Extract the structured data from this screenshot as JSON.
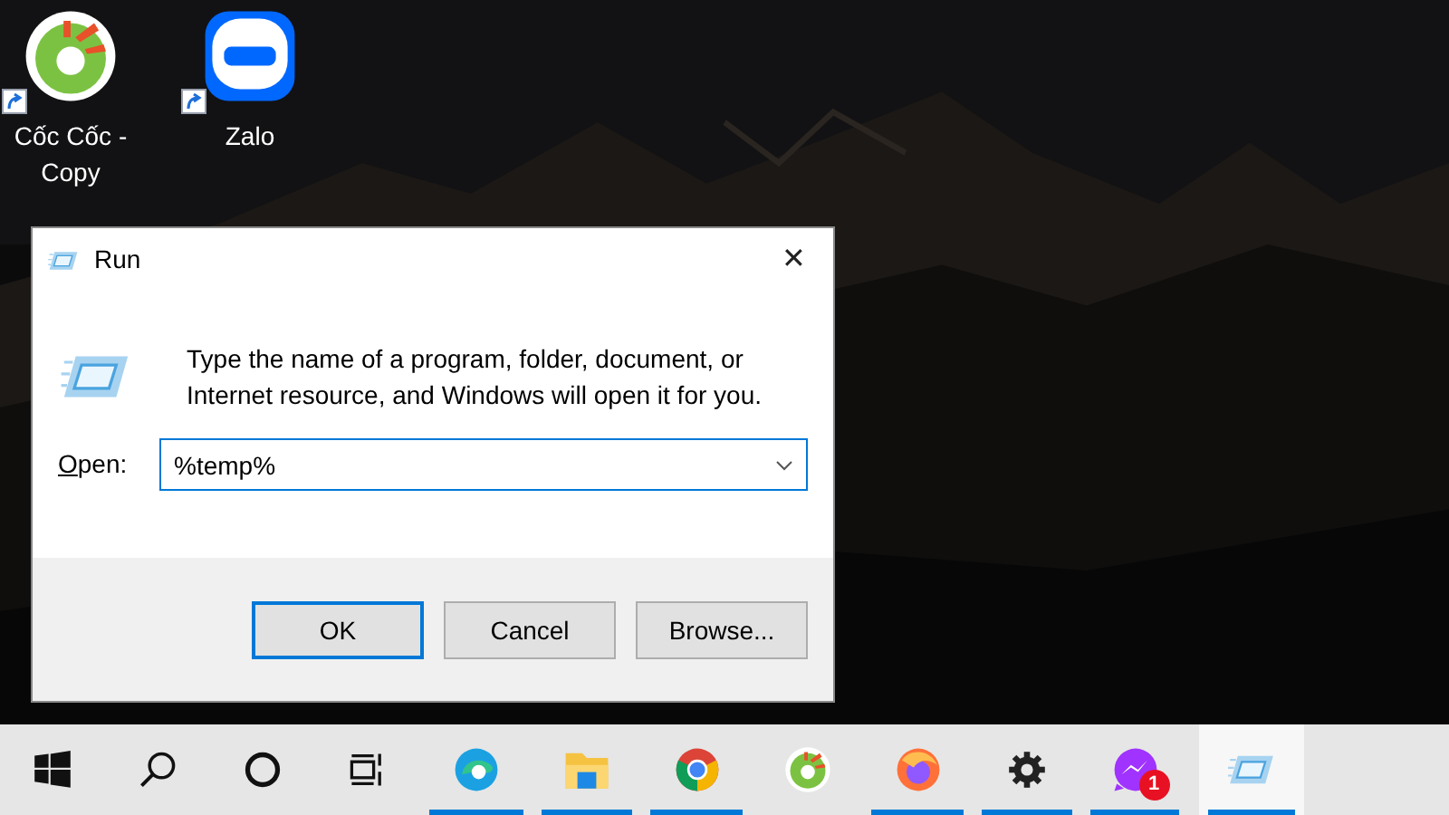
{
  "desktop": {
    "icons": [
      {
        "kind": "coccoc",
        "label": "Cốc Cốc - Copy",
        "shortcut": true
      },
      {
        "kind": "zalo",
        "label": "Zalo",
        "shortcut": true
      }
    ]
  },
  "dialog": {
    "title": "Run",
    "close": "✕",
    "message": "Type the name of a program, folder, document, or Internet resource, and Windows will open it for you.",
    "open_label": "**O**pen:",
    "open_value": "%temp%",
    "buttons": [
      {
        "label": "OK",
        "default": true
      },
      {
        "label": "Cancel",
        "default": false
      },
      {
        "label": "Browse...",
        "default": false
      }
    ]
  },
  "taskbar": {
    "items": [
      {
        "kind": "start",
        "running": false,
        "active": false
      },
      {
        "kind": "search",
        "running": false,
        "active": false
      },
      {
        "kind": "cortana",
        "running": false,
        "active": false
      },
      {
        "kind": "taskview",
        "running": false,
        "active": false
      },
      {
        "kind": "edge",
        "running": true,
        "active": false
      },
      {
        "kind": "explorer",
        "running": true,
        "active": false
      },
      {
        "kind": "chrome",
        "running": true,
        "active": false
      },
      {
        "kind": "coccoc",
        "running": false,
        "active": false
      },
      {
        "kind": "firefox",
        "running": true,
        "active": false
      },
      {
        "kind": "settings",
        "running": true,
        "active": false
      },
      {
        "kind": "messenger",
        "running": true,
        "active": false,
        "badge": "1"
      },
      {
        "kind": "run",
        "running": true,
        "active": true
      }
    ]
  }
}
